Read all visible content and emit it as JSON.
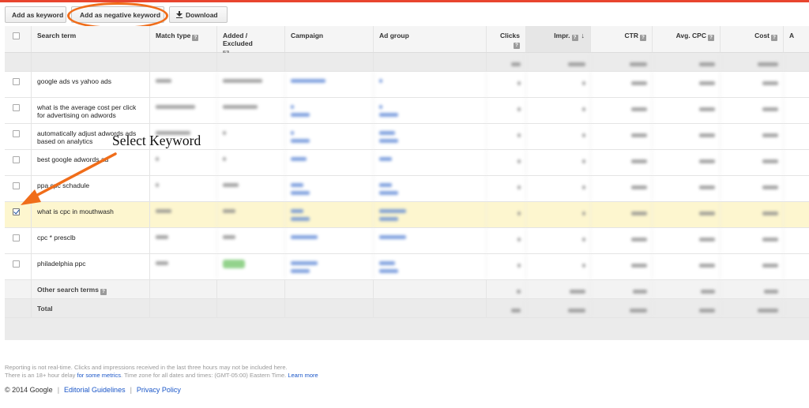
{
  "toolbar": {
    "add_keyword": "Add as keyword",
    "add_negative": "Add as negative keyword",
    "download": "Download"
  },
  "columns": {
    "search_term": "Search term",
    "match_type": "Match type",
    "added_excluded": "Added / Excluded",
    "campaign": "Campaign",
    "ad_group": "Ad group",
    "clicks": "Clicks",
    "impr": "Impr.",
    "ctr": "CTR",
    "avg_cpc": "Avg. CPC",
    "cost": "Cost",
    "more": "A"
  },
  "rows": [
    {
      "term": "google ads vs yahoo ads",
      "checked": false
    },
    {
      "term": "what is the average cost per click for advertising on adwords",
      "checked": false
    },
    {
      "term": "automatically adjust adwords ads based on analytics",
      "checked": false
    },
    {
      "term": "best google adwords ad",
      "checked": false
    },
    {
      "term": "ppa cpc schadule",
      "checked": false
    },
    {
      "term": "what is cpc in mouthwash",
      "checked": true
    },
    {
      "term": "cpc * presclb",
      "checked": false
    },
    {
      "term": "philadelphia ppc",
      "checked": false
    }
  ],
  "other_terms": "Other search terms",
  "total": "Total",
  "annotation": "Select Keyword",
  "footer": {
    "line1": "Reporting is not real-time. Clicks and impressions received in the last three hours may not be included here.",
    "line2_a": "There is an 18+ hour delay",
    "line2_link1": "for some metrics",
    "line2_b": ". Time zone for all dates and times: (GMT-05:00) Eastern Time.",
    "line2_link2": "Learn more",
    "copyright": "© 2014 Google",
    "link_guidelines": "Editorial Guidelines",
    "link_privacy": "Privacy Policy"
  },
  "colors": {
    "accent_orange": "#f06d1a",
    "top_bar": "#e8452f",
    "link_blue": "#1a56c8",
    "selected_row": "#fdf6cf"
  }
}
